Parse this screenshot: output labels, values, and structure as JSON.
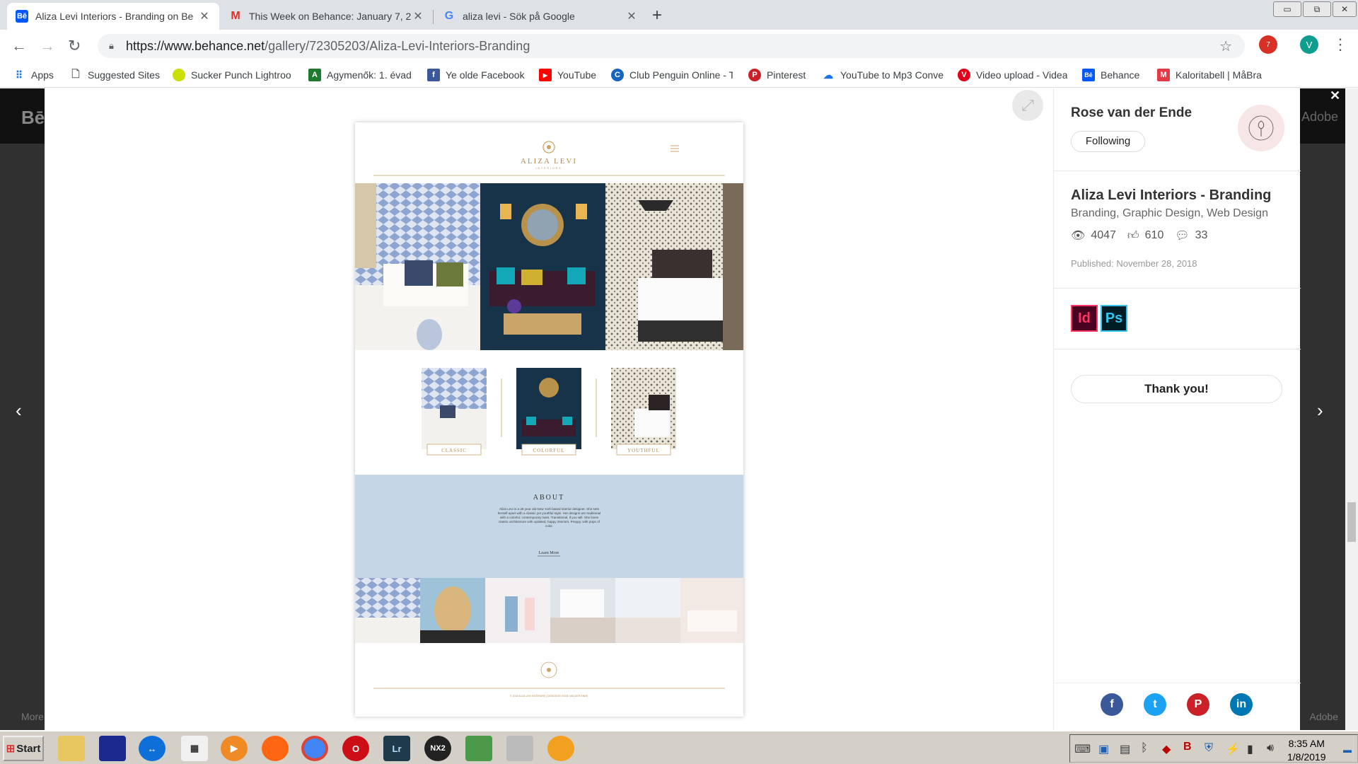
{
  "tabs": [
    {
      "title": "Aliza Levi Interiors - Branding on Be",
      "favicon": "behance-favicon",
      "active": true
    },
    {
      "title": "This Week on Behance: January 7, 2",
      "favicon": "gmail-favicon",
      "active": false
    },
    {
      "title": "aliza levi - Sök på Google",
      "favicon": "google-favicon",
      "active": false
    }
  ],
  "newtab_label": "+",
  "window_controls": {
    "minimize": "▭",
    "restore": "⧉",
    "close": "✕"
  },
  "address": {
    "host": "https://www.behance.net",
    "path": "/gallery/72305203/Aliza-Levi-Interiors-Branding"
  },
  "extensions": {
    "badge_count": "7",
    "profile_initial": "V"
  },
  "bookmarks": [
    {
      "label": "Apps",
      "icon": "apps-grid-icon"
    },
    {
      "label": "Suggested Sites",
      "icon": "page-icon"
    },
    {
      "label": "Sucker Punch Lightroo",
      "icon": "lightroom-icon"
    },
    {
      "label": "Agymenők: 1. évad",
      "icon": "agymenok-icon"
    },
    {
      "label": "Ye olde Facebook",
      "icon": "facebook-icon"
    },
    {
      "label": "YouTube",
      "icon": "youtube-icon"
    },
    {
      "label": "Club Penguin Online - T",
      "icon": "club-penguin-icon"
    },
    {
      "label": "Pinterest",
      "icon": "pinterest-icon"
    },
    {
      "label": "YouTube to Mp3 Conve",
      "icon": "cloud-download-icon"
    },
    {
      "label": "Video upload - Videa",
      "icon": "videa-icon"
    },
    {
      "label": "Behance",
      "icon": "behance-icon"
    },
    {
      "label": "Kaloritabell | MåBra",
      "icon": "mabra-icon"
    }
  ],
  "background": {
    "logo": "Bē",
    "adobe": "Adobe",
    "more": "More",
    "adobe_footer": "Adobe"
  },
  "project_image": {
    "brand": "ALIZA LEVI",
    "brand_sub": "INTERIORS",
    "styles": [
      "CLASSIC",
      "COLORFUL",
      "YOUTHFUL"
    ],
    "about_title": "ABOUT",
    "about_text": "Aliza Levi is a 26 year old New York based interior designer. She sets herself apart with a classic yet youthful style. Her designs are traditional with a colorful, contemporary twist. Transitional, if you will. She loves classic architecture with updated, happy interiors. Preppy, with pops of color.",
    "learn_more": "Learn More",
    "footer_text": "© 2018 ALIZA LEVI INTERIORS | DESIGN BY ROSE VAN DER ENDE"
  },
  "sidebar": {
    "owner": "Rose van der Ende",
    "follow_label": "Following",
    "project_title": "Aliza Levi Interiors - Branding",
    "fields": "Branding, Graphic Design, Web Design",
    "views": "4047",
    "appreciations": "610",
    "comments": "33",
    "published": "Published: November 28, 2018",
    "tools": [
      {
        "label": "Id",
        "name": "indesign-icon"
      },
      {
        "label": "Ps",
        "name": "photoshop-icon"
      }
    ],
    "thanks_label": "Thank you!",
    "social": [
      {
        "label": "f",
        "name": "facebook-share-icon",
        "color": "#3b5998"
      },
      {
        "label": "t",
        "name": "twitter-share-icon",
        "color": "#1da1f2"
      },
      {
        "label": "P",
        "name": "pinterest-share-icon",
        "color": "#cb2027"
      },
      {
        "label": "in",
        "name": "linkedin-share-icon",
        "color": "#0077b5"
      }
    ]
  },
  "taskbar": {
    "start_label": "Start",
    "time": "8:35 AM",
    "date": "1/8/2019",
    "apps": [
      {
        "name": "file-explorer-icon",
        "label": ""
      },
      {
        "name": "save-floppy-icon",
        "label": ""
      },
      {
        "name": "teamviewer-icon",
        "label": ""
      },
      {
        "name": "calendar-icon",
        "label": ""
      },
      {
        "name": "media-player-icon",
        "label": ""
      },
      {
        "name": "firefox-icon",
        "label": ""
      },
      {
        "name": "chrome-icon",
        "label": ""
      },
      {
        "name": "opera-icon",
        "label": ""
      },
      {
        "name": "lightroom-app-icon",
        "label": "Lr"
      },
      {
        "name": "nx2-icon",
        "label": "NX2"
      },
      {
        "name": "image-viewer-icon",
        "label": ""
      },
      {
        "name": "camera-icon",
        "label": ""
      },
      {
        "name": "paint-icon",
        "label": ""
      }
    ]
  },
  "colors": {
    "accent": "#c9a36a",
    "behance_blue": "#0057ff",
    "about_bg": "#c5d6e6"
  }
}
